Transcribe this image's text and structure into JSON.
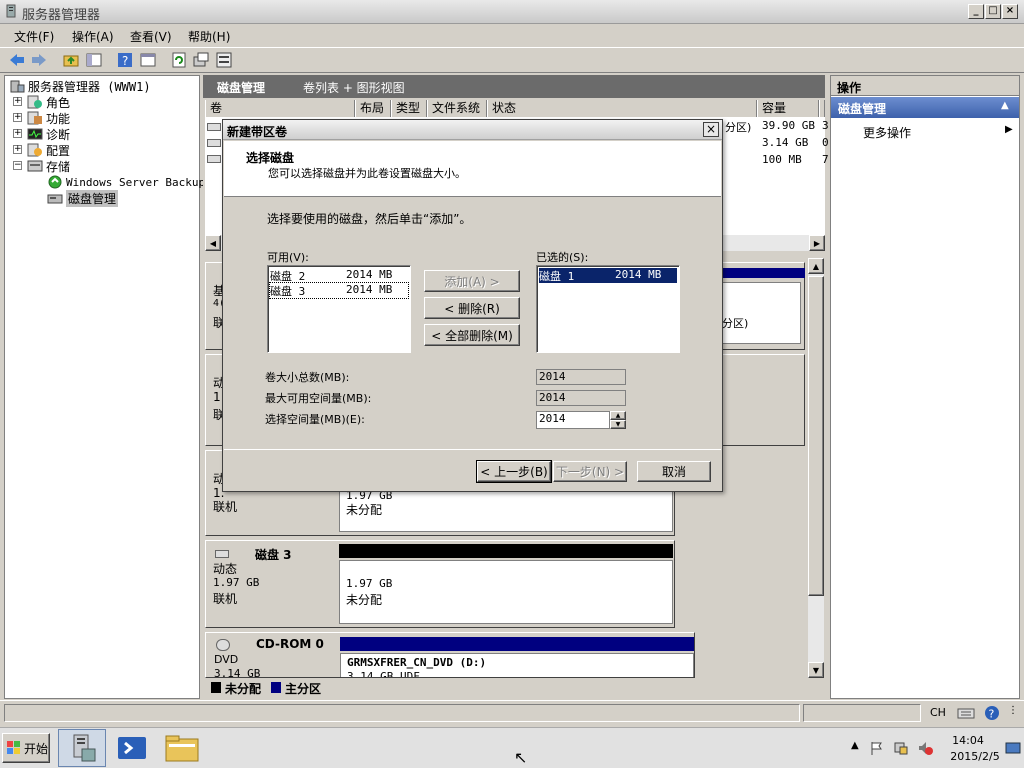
{
  "window": {
    "title": "服务器管理器",
    "minimize": "_",
    "restore": "□",
    "close": "×"
  },
  "menu": [
    "文件(F)",
    "操作(A)",
    "查看(V)",
    "帮助(H)"
  ],
  "tree": {
    "root": "服务器管理器 (WWW1)",
    "items": [
      "角色",
      "功能",
      "诊断",
      "配置",
      "存储"
    ],
    "storage_children": [
      "Windows Server Backup",
      "磁盘管理"
    ]
  },
  "center": {
    "title": "磁盘管理",
    "subtitle": "卷列表 + 图形视图",
    "columns": [
      "卷",
      "布局",
      "类型",
      "文件系统",
      "状态",
      "容量",
      "↕"
    ],
    "rows_right": [
      {
        "status_tail": "分区)",
        "capacity": "39.90 GB",
        "tail": "3"
      },
      {
        "status_tail": "",
        "capacity": "3.14 GB",
        "tail": "0"
      },
      {
        "status_tail": "",
        "capacity": "100 MB",
        "tail": "7"
      }
    ],
    "disk_fragments": {
      "a": "基",
      "b": "4(",
      "c": "联",
      "d": "动",
      "e": "1",
      "f": "联",
      "g": "动",
      "h": "1.",
      "i": "联机",
      "part_tail": "分区)"
    },
    "disk2_partition": {
      "size": "1.97 GB",
      "state": "未分配"
    },
    "disk3": {
      "name": "磁盘 3",
      "type": "动态",
      "size": "1.97 GB",
      "status": "联机",
      "part_size": "1.97 GB",
      "part_state": "未分配"
    },
    "cdrom": {
      "name": "CD-ROM 0",
      "type": "DVD",
      "size": "3.14 GB",
      "label": "GRMSXFRER_CN_DVD  (D:)",
      "detail": "3.14 GB UDF"
    },
    "legend": [
      {
        "label": "未分配",
        "color": "#000000"
      },
      {
        "label": "主分区",
        "color": "#000080"
      }
    ]
  },
  "actions": {
    "header": "操作",
    "section": "磁盘管理",
    "more": "更多操作"
  },
  "dialog": {
    "title": "新建带区卷",
    "heading": "选择磁盘",
    "subheading": "您可以选择磁盘并为此卷设置磁盘大小。",
    "instruction": "选择要使用的磁盘，然后单击“添加”。",
    "available_label": "可用(V):",
    "available": [
      {
        "name": "磁盘 2",
        "size": "2014 MB"
      },
      {
        "name": "磁盘 3",
        "size": "2014 MB"
      }
    ],
    "selected_label": "已选的(S):",
    "selected": [
      {
        "name": "磁盘 1",
        "size": "2014 MB"
      }
    ],
    "add": "添加(A) >",
    "remove": "< 删除(R)",
    "remove_all": "< 全部删除(M)",
    "total_label": "卷大小总数(MB):",
    "total_value": "2014",
    "max_label": "最大可用空间量(MB):",
    "max_value": "2014",
    "select_label": "选择空间量(MB)(E):",
    "select_value": "2014",
    "back": "< 上一步(B)",
    "next": "下一步(N) >",
    "cancel": "取消",
    "close": "×"
  },
  "taskbar": {
    "start": "开始",
    "lang": "CH",
    "time": "14:04",
    "date": "2015/2/5"
  },
  "colors": {
    "accent": "#0a246a",
    "header_dark": "#6b6b6b",
    "action_header": "#4a6fb5"
  }
}
